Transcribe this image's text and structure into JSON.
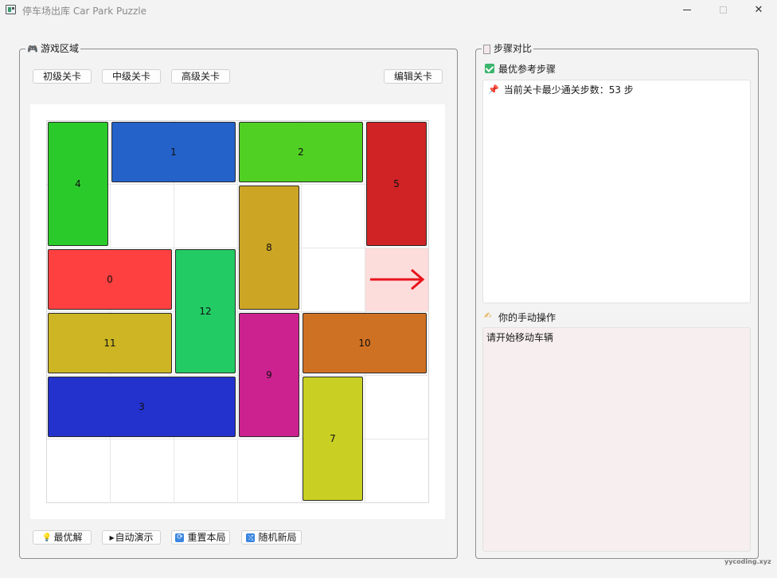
{
  "window": {
    "title": "停车场出库 Car Park Puzzle",
    "buttons": {
      "minimize": "minimize",
      "maximize": "maximize",
      "close": "✕"
    }
  },
  "game_area": {
    "title": "游戏区域",
    "title_icon": "gamepad-icon",
    "level_buttons": [
      "初级关卡",
      "中级关卡",
      "高级关卡"
    ],
    "edit_button": "编辑关卡",
    "bottom_buttons": [
      {
        "label": "最优解",
        "icon": "lightbulb-icon"
      },
      {
        "label": "自动演示",
        "icon": "play-icon"
      },
      {
        "label": "重置本局",
        "icon": "refresh-icon"
      },
      {
        "label": "随机新局",
        "icon": "shuffle-icon"
      }
    ]
  },
  "board": {
    "cols": 6,
    "rows": 6,
    "exit": {
      "row": 2,
      "col": 5,
      "arrow_color": "#e8131b",
      "cell_color": "#fddcdc"
    },
    "cars": [
      {
        "id": "4",
        "row": 0,
        "col": 0,
        "w": 1,
        "h": 2,
        "color": "#2bca2b"
      },
      {
        "id": "1",
        "row": 0,
        "col": 1,
        "w": 2,
        "h": 1,
        "color": "#2462ca"
      },
      {
        "id": "2",
        "row": 0,
        "col": 3,
        "w": 2,
        "h": 1,
        "color": "#51d024"
      },
      {
        "id": "5",
        "row": 0,
        "col": 5,
        "w": 1,
        "h": 2,
        "color": "#cf2326"
      },
      {
        "id": "8",
        "row": 1,
        "col": 3,
        "w": 1,
        "h": 2,
        "color": "#cca524"
      },
      {
        "id": "0",
        "row": 2,
        "col": 0,
        "w": 2,
        "h": 1,
        "color": "#fe4040"
      },
      {
        "id": "12",
        "row": 2,
        "col": 2,
        "w": 1,
        "h": 2,
        "color": "#23cb65"
      },
      {
        "id": "11",
        "row": 3,
        "col": 0,
        "w": 2,
        "h": 1,
        "color": "#cdb523"
      },
      {
        "id": "9",
        "row": 3,
        "col": 3,
        "w": 1,
        "h": 2,
        "color": "#cc2290"
      },
      {
        "id": "10",
        "row": 3,
        "col": 4,
        "w": 2,
        "h": 1,
        "color": "#cf7123"
      },
      {
        "id": "3",
        "row": 4,
        "col": 0,
        "w": 3,
        "h": 1,
        "color": "#2332cd"
      },
      {
        "id": "7",
        "row": 4,
        "col": 4,
        "w": 1,
        "h": 2,
        "color": "#c9d023"
      }
    ]
  },
  "steps": {
    "title": "步骤对比",
    "title_icon": "clipboard-icon",
    "optimal_label": "最优参考步骤",
    "optimal_text": "当前关卡最少通关步数：53 步",
    "optimal_text_icon": "pushpin-icon",
    "manual_label": "你的手动操作",
    "manual_icon": "writing-hand-icon",
    "manual_text": "请开始移动车辆"
  },
  "watermark": "yycoding.xyz",
  "colors": {
    "checkbox": "#3bb56c",
    "manual_panel_bg": "#f6eeef"
  }
}
